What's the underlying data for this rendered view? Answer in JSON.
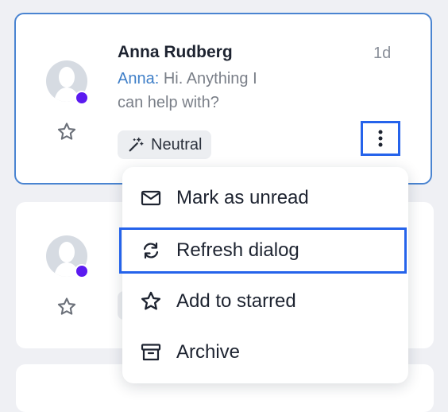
{
  "conversations": [
    {
      "name": "Anna Rudberg",
      "time": "1d",
      "sender": "Anna:",
      "message_line1": " Hi. Anything I",
      "message_line2": "can help with?",
      "tag": "Neutral"
    },
    {
      "name": "",
      "time": "",
      "sender": "",
      "message_line1": "",
      "message_line2": "",
      "tag": ""
    }
  ],
  "menu": {
    "items": [
      {
        "label": "Mark as unread",
        "icon": "envelope-icon"
      },
      {
        "label": "Refresh dialog",
        "icon": "refresh-icon"
      },
      {
        "label": "Add to starred",
        "icon": "star-icon"
      },
      {
        "label": "Archive",
        "icon": "archive-icon"
      }
    ]
  },
  "colors": {
    "accent": "#2563eb",
    "status": "#5b1af0",
    "sender": "#3f7fc8"
  }
}
